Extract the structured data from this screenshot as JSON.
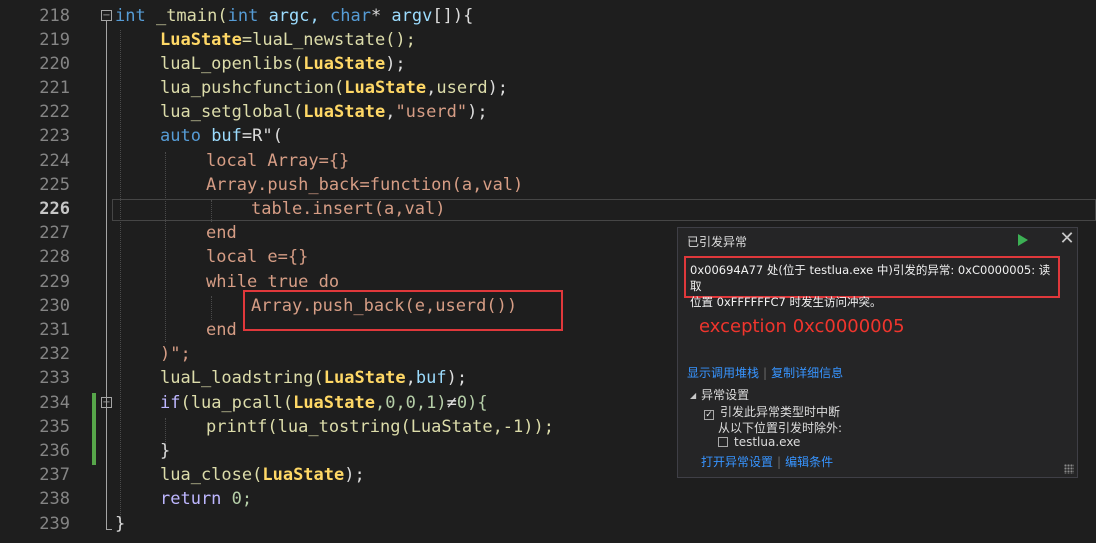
{
  "line_numbers": [
    "218",
    "219",
    "220",
    "221",
    "222",
    "223",
    "224",
    "225",
    "226",
    "227",
    "228",
    "229",
    "230",
    "231",
    "232",
    "233",
    "234",
    "235",
    "236",
    "237",
    "238",
    "239"
  ],
  "code": {
    "l218": {
      "a": "int",
      "b": " _tmain(",
      "c": "int",
      "d": " argc, ",
      "e": "char",
      "f": "* ",
      "g": "argv",
      "h": "[]){"
    },
    "l219": {
      "a": "LuaState",
      "b": "=luaL_newstate();"
    },
    "l220": {
      "a": "luaL_openlibs(",
      "b": "LuaState",
      "c": ");"
    },
    "l221": {
      "a": "lua_pushcfunction(",
      "b": "LuaState",
      ",": ",",
      "c": "userd",
      "d": ");"
    },
    "l222": {
      "a": "lua_setglobal(",
      "b": "LuaState",
      ",": ",",
      "c": "\"userd\"",
      "d": ");"
    },
    "l223": {
      "a": "auto",
      "b": " buf",
      "c": "=R\"("
    },
    "l224": {
      "a": "local Array={}"
    },
    "l225": {
      "a": "Array.push_back=function(a,val)"
    },
    "l226": {
      "a": "table.insert(a,val)"
    },
    "l227": {
      "a": "end"
    },
    "l228": {
      "a": "local e={}"
    },
    "l229": {
      "a": "while true do"
    },
    "l230": {
      "a": "Array.push_back(e,userd())"
    },
    "l231": {
      "a": "end"
    },
    "l232": {
      "a": ")\";"
    },
    "l233": {
      "a": "luaL_loadstring(",
      "b": "LuaState",
      ",": ",",
      "c": "buf",
      "d": ");"
    },
    "l234": {
      "a": "if",
      "b": "(lua_pcall(",
      "c": "LuaState",
      "d": ",0,0,1)",
      "e": "≠",
      "f": "0){"
    },
    "l235": {
      "a": "printf(lua_tostring(LuaState,-1));"
    },
    "l236": {
      "a": "}"
    },
    "l237": {
      "a": "lua_close(",
      "b": "LuaState",
      "c": ");"
    },
    "l238": {
      "a": "return",
      "b": " 0;"
    },
    "l239": {
      "a": "}"
    }
  },
  "popup": {
    "title": "已引发异常",
    "message_line1": "0x00694A77 处(位于 testlua.exe 中)引发的异常: 0xC0000005: 读取",
    "message_line2": "位置 0xFFFFFFC7 时发生访问冲突。",
    "annotation": "exception  0xc0000005",
    "link_callstack": "显示调用堆栈",
    "link_copy": "复制详细信息",
    "section_title": "异常设置",
    "cb_break_label": "引发此异常类型时中断",
    "except_label": "从以下位置引发时除外:",
    "cb_module_label": "testlua.exe",
    "link_open_settings": "打开异常设置",
    "link_edit_conditions": "编辑条件",
    "cb_break_checked": "✓",
    "cb_module_checked": ""
  },
  "colors": {
    "accent_red": "#e0383b",
    "run_green": "#3cb054",
    "link_blue": "#3794ff"
  }
}
